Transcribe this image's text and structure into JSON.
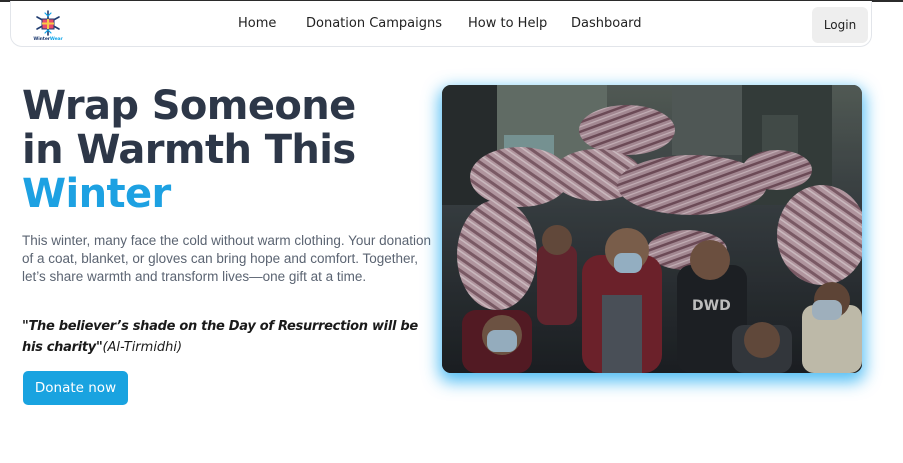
{
  "brand": {
    "logo_word_1": "Winter",
    "logo_word_2": "Wear",
    "logo_icon": "gift-box-snowflake-icon"
  },
  "nav": {
    "links": [
      "Home",
      "Donation Campaigns",
      "How to Help",
      "Dashboard"
    ],
    "login_label": "Login"
  },
  "hero": {
    "title_line_1": "Wrap Someone",
    "title_line_2": "in Warmth This",
    "title_line_3": "Winter",
    "description": "This winter, many face the cold without warm clothing. Your donation of a coat, blanket, or gloves can bring hope and comfort. Together, let’s share warmth and transform lives—one gift at a time.",
    "quote": "\"The believer’s shade on the Day of Resurrection will be his charity\"",
    "quote_source": "(Al-Tirmidhi)",
    "cta_label": "Donate now",
    "image_icon": "children-carrying-blankets-photo"
  },
  "colors": {
    "accent": "#1da1e2",
    "title": "#2d3748",
    "button": "#19a3e0",
    "photo_glow": "#1eaaf0"
  }
}
